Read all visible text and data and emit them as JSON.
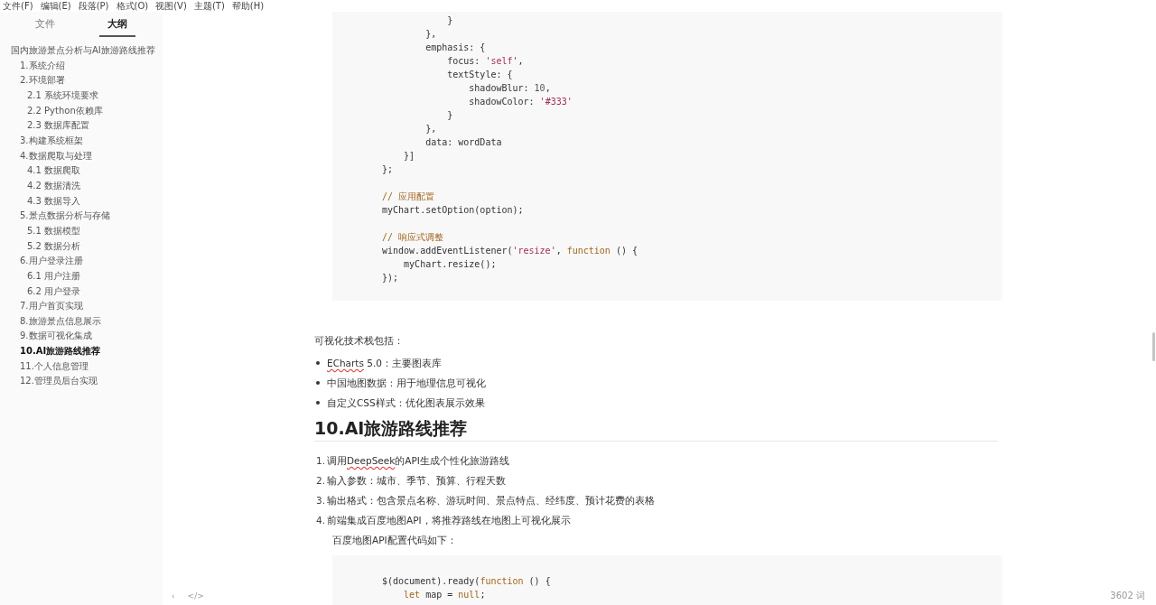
{
  "menu_bar": [
    "文件(F)",
    "编辑(E)",
    "段落(P)",
    "格式(O)",
    "视图(V)",
    "主题(T)",
    "帮助(H)"
  ],
  "sidebar": {
    "tabs": [
      {
        "label": "文件",
        "selected": false
      },
      {
        "label": "大纲",
        "selected": true
      }
    ],
    "outline": [
      {
        "label": "国内旅游景点分析与AI旅游路线推荐",
        "selected": false,
        "children": [
          {
            "label": "1.系统介绍",
            "selected": false
          },
          {
            "label": "2.环境部署",
            "selected": false,
            "children": [
              {
                "label": "2.1 系统环境要求",
                "selected": false
              },
              {
                "label": "2.2 Python依赖库",
                "selected": false
              },
              {
                "label": "2.3 数据库配置",
                "selected": false
              }
            ]
          },
          {
            "label": "3.构建系统框架",
            "selected": false
          },
          {
            "label": "4.数据爬取与处理",
            "selected": false,
            "children": [
              {
                "label": "4.1 数据爬取",
                "selected": false
              },
              {
                "label": "4.2 数据清洗",
                "selected": false
              },
              {
                "label": "4.3 数据导入",
                "selected": false
              }
            ]
          },
          {
            "label": "5.景点数据分析与存储",
            "selected": false,
            "children": [
              {
                "label": "5.1 数据模型",
                "selected": false
              },
              {
                "label": "5.2 数据分析",
                "selected": false
              }
            ]
          },
          {
            "label": "6.用户登录注册",
            "selected": false,
            "children": [
              {
                "label": "6.1 用户注册",
                "selected": false
              },
              {
                "label": "6.2 用户登录",
                "selected": false
              }
            ]
          },
          {
            "label": "7.用户首页实现",
            "selected": false
          },
          {
            "label": "8.旅游景点信息展示",
            "selected": false
          },
          {
            "label": "9.数据可视化集成",
            "selected": false
          },
          {
            "label": "10.AI旅游路线推荐",
            "selected": true
          },
          {
            "label": "11.个人信息管理",
            "selected": false
          },
          {
            "label": "12.管理员后台实现",
            "selected": false
          }
        ]
      }
    ]
  },
  "document": {
    "code_block_1": [
      {
        "kind": "code",
        "tokens": [
          {
            "text": "            }",
            "kind": "plain"
          }
        ]
      },
      {
        "kind": "code",
        "tokens": [
          {
            "text": "        },",
            "kind": "plain"
          }
        ]
      },
      {
        "kind": "code",
        "tokens": [
          {
            "text": "        emphasis: {",
            "kind": "plain"
          }
        ]
      },
      {
        "kind": "code",
        "tokens": [
          {
            "text": "            focus: ",
            "kind": "plain"
          },
          {
            "text": "'self'",
            "kind": "string"
          },
          {
            "text": ",",
            "kind": "plain"
          }
        ]
      },
      {
        "kind": "code",
        "tokens": [
          {
            "text": "            textStyle: {",
            "kind": "plain"
          }
        ]
      },
      {
        "kind": "code",
        "tokens": [
          {
            "text": "                shadowBlur: ",
            "kind": "plain"
          },
          {
            "text": "10",
            "kind": "number"
          },
          {
            "text": ",",
            "kind": "plain"
          }
        ]
      },
      {
        "kind": "code",
        "tokens": [
          {
            "text": "                shadowColor: ",
            "kind": "plain"
          },
          {
            "text": "'#333'",
            "kind": "string"
          }
        ]
      },
      {
        "kind": "code",
        "tokens": [
          {
            "text": "            }",
            "kind": "plain"
          }
        ]
      },
      {
        "kind": "code",
        "tokens": [
          {
            "text": "        },",
            "kind": "plain"
          }
        ]
      },
      {
        "kind": "code",
        "tokens": [
          {
            "text": "        data: wordData",
            "kind": "plain"
          }
        ]
      },
      {
        "kind": "code",
        "tokens": [
          {
            "text": "    }]",
            "kind": "plain"
          }
        ]
      },
      {
        "kind": "code",
        "tokens": [
          {
            "text": "};",
            "kind": "plain"
          }
        ]
      },
      {
        "kind": "blank"
      },
      {
        "kind": "code",
        "tokens": [
          {
            "text": "// 应用配置",
            "kind": "comment"
          }
        ]
      },
      {
        "kind": "code",
        "tokens": [
          {
            "text": "myChart.setOption(option);",
            "kind": "plain"
          }
        ]
      },
      {
        "kind": "blank"
      },
      {
        "kind": "code",
        "tokens": [
          {
            "text": "// 响应式调整",
            "kind": "comment"
          }
        ]
      },
      {
        "kind": "code",
        "tokens": [
          {
            "text": "window.addEventListener(",
            "kind": "plain"
          },
          {
            "text": "'resize'",
            "kind": "string"
          },
          {
            "text": ", ",
            "kind": "plain"
          },
          {
            "text": "function",
            "kind": "keyword"
          },
          {
            "text": " () {",
            "kind": "plain"
          }
        ]
      },
      {
        "kind": "code",
        "tokens": [
          {
            "text": "    myChart.resize();",
            "kind": "plain"
          }
        ]
      },
      {
        "kind": "code",
        "tokens": [
          {
            "text": "});",
            "kind": "plain"
          }
        ]
      }
    ],
    "paragraph": "可视化技术栈包括：",
    "bullets": [
      [
        {
          "text": "ECharts",
          "misspelled": true
        },
        {
          "text": " 5.0：主要图表库",
          "misspelled": false
        }
      ],
      [
        {
          "text": "中国地图数据：用于地理信息可视化",
          "misspelled": false
        }
      ],
      [
        {
          "text": "自定义CSS样式：优化图表展示效果",
          "misspelled": false
        }
      ]
    ],
    "heading": "10.AI旅游路线推荐",
    "steps": [
      {
        "number": "1.",
        "parts": [
          {
            "text": "调用",
            "misspelled": false
          },
          {
            "text": "DeepSeek",
            "misspelled": true
          },
          {
            "text": "的API生成个性化旅游路线",
            "misspelled": false
          }
        ]
      },
      {
        "number": "2.",
        "parts": [
          {
            "text": "输入参数：城市、季节、预算、行程天数",
            "misspelled": false
          }
        ]
      },
      {
        "number": "3.",
        "parts": [
          {
            "text": "输出格式：包含景点名称、游玩时间、景点特点、经纬度、预计花费的表格",
            "misspelled": false
          }
        ]
      },
      {
        "number": "4.",
        "parts": [
          {
            "text": "前端集成百度地图API，将推荐路线在地图上可视化展示",
            "misspelled": false
          }
        ]
      }
    ],
    "step_note": "百度地图API配置代码如下：",
    "code_block_2": [
      {
        "kind": "code",
        "tokens": [
          {
            "text": "$(document).ready(",
            "kind": "plain"
          },
          {
            "text": "function",
            "kind": "keyword"
          },
          {
            "text": " () {",
            "kind": "plain"
          }
        ]
      },
      {
        "kind": "code",
        "tokens": [
          {
            "text": "    let",
            "kind": "keyword"
          },
          {
            "text": " map = ",
            "kind": "plain"
          },
          {
            "text": "null",
            "kind": "keyword"
          },
          {
            "text": ";",
            "kind": "plain"
          }
        ]
      }
    ]
  },
  "status_bar": {
    "toggle_sidebar": "‹",
    "source_mode": "</>",
    "word_count": "3602 词"
  }
}
